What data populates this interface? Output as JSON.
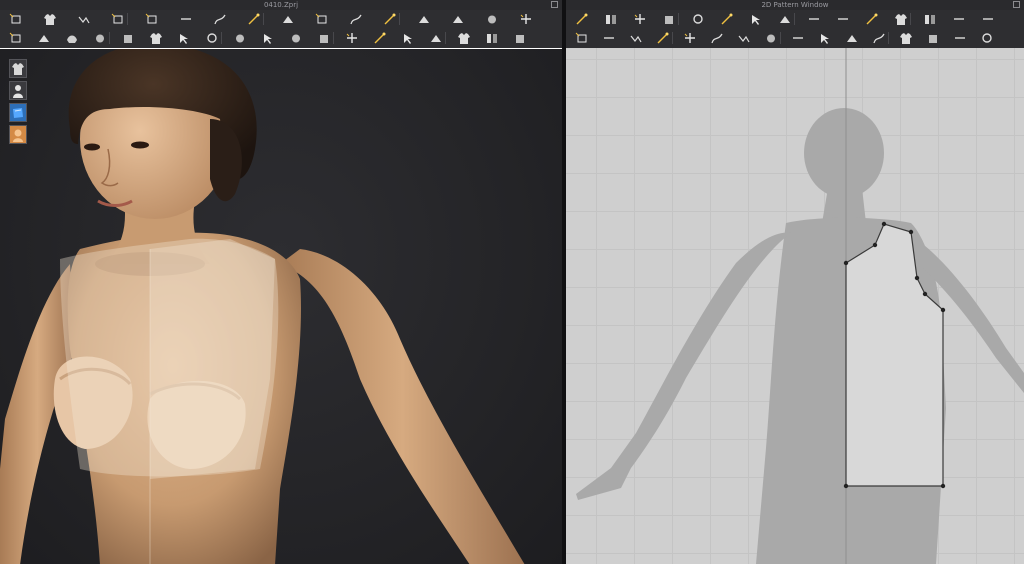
{
  "window_3d": {
    "title": "0410.Zprj"
  },
  "window_2d": {
    "title": "2D Pattern Window"
  },
  "toolbar_3d_row1": [
    "select-move-icon",
    "transform-icon",
    "select-mesh-icon",
    "box-select-icon",
    "lasso-icon",
    "edit-pin-icon",
    "fold-icon",
    "shirt-icon",
    "tack-icon",
    "tack-box-icon",
    "fold-arrange-icon",
    "garment-front-icon",
    "garment-back-icon",
    "measure-icon",
    "tape-icon",
    "ruler-icon"
  ],
  "toolbar_3d_row2": [
    "avatar-pose-icon",
    "arrangement-icon",
    "arrangement-point-icon",
    "cut-icon",
    "avatar-edit-icon",
    "pin-icon",
    "pin-box-icon",
    "shirring-icon",
    "stitch-icon",
    "button-icon",
    "buttonhole-icon",
    "line-icon",
    "zipper-icon",
    "bag-icon",
    "tape-seam-icon",
    "measure-box-icon",
    "flip-icon",
    "garment-icon",
    "garment-alt-icon"
  ],
  "toolbar_2d_row1": [
    "edit-pattern-icon",
    "transform-pattern-icon",
    "edit-curvature-icon",
    "edit-curve-point-icon",
    "add-point-icon",
    "add-curve-point-icon",
    "polygon-icon",
    "rectangle-icon",
    "ellipse-icon",
    "internal-polygon-icon",
    "internal-rectangle-icon",
    "internal-circle-icon",
    "dart-icon",
    "fold-lines-icon",
    "trace-icon"
  ],
  "toolbar_2d_row2": [
    "edit-sewing-icon",
    "segment-sewing-icon",
    "free-sewing-icon",
    "sewing-list-icon",
    "iron-icon",
    "gathering-icon",
    "pleat-icon",
    "shirring-2d-icon",
    "elastic-icon",
    "pin-2d-icon",
    "symmetry-icon",
    "line-2d-icon",
    "curve-line-icon",
    "baseline-icon",
    "grain-icon",
    "measure-2d-icon"
  ],
  "side_buttons": [
    "garment-display-icon",
    "avatar-display-icon",
    "fabric-display-icon",
    "avatar-skin-icon"
  ],
  "colors": {
    "skin": "#c99a73",
    "hair": "#2a1e17",
    "fabric": "#f4e8d8",
    "pattern_fill": "#d8d8d8",
    "silhouette": "#a9a9a9"
  }
}
